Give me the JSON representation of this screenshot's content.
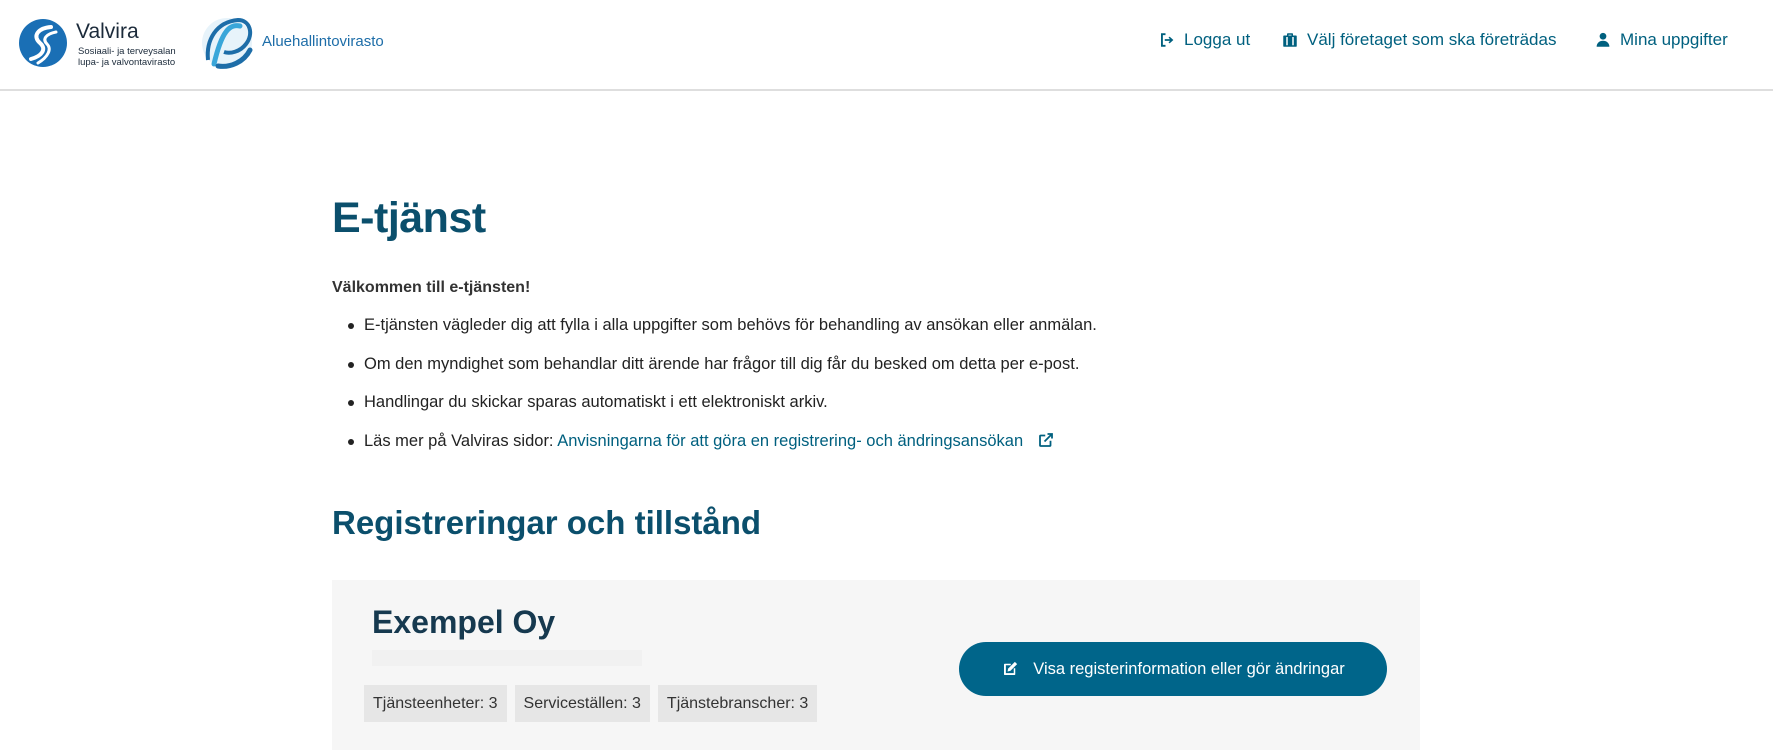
{
  "header": {
    "valvira_logo": {
      "name": "Valvira",
      "subtitle_line1": "Sosiaali- ja terveysalan",
      "subtitle_line2": "lupa- ja valvontavirasto"
    },
    "avi_logo": {
      "name": "Aluehallintovirasto"
    },
    "nav": [
      {
        "label": "Logga ut",
        "icon": "logout-icon"
      },
      {
        "label": "Välj företaget som ska företrädas",
        "icon": "briefcase-icon"
      },
      {
        "label": "Mina uppgifter",
        "icon": "user-icon"
      }
    ]
  },
  "main": {
    "title": "E-tjänst",
    "welcome": "Välkommen till e-tjänsten!",
    "bullets": [
      "E-tjänsten vägleder dig att fylla i alla uppgifter som behövs för behandling av ansökan eller anmälan.",
      "Om den myndighet som behandlar ditt ärende har frågor till dig får du besked om detta per e-post.",
      "Handlingar du skickar sparas automatiskt i ett elektroniskt arkiv."
    ],
    "read_more_prefix": "Läs mer på Valviras sidor: ",
    "read_more_link": "Anvisningarna för att göra en registrering- och ändringsansökan",
    "section_title": "Registreringar och tillstånd",
    "card": {
      "company": "Exempel Oy",
      "chips": [
        "Tjänsteenheter: 3",
        "Serviceställen: 3",
        "Tjänstebranscher: 3"
      ],
      "button_label": "Visa registerinformation eller gör ändringar"
    }
  },
  "colors": {
    "accent": "#00658a",
    "heading": "#0b4f6c",
    "link": "#00607f",
    "card_bg": "#f6f6f6"
  }
}
